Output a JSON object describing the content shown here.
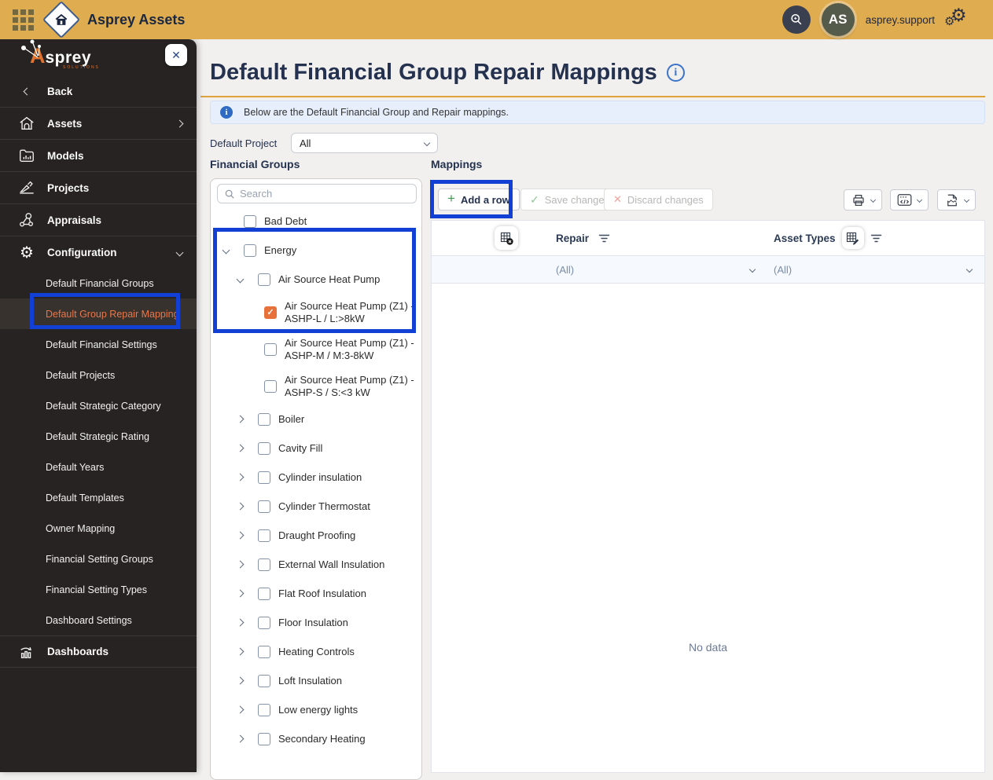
{
  "topbar": {
    "app_title": "Asprey Assets",
    "username": "asprey.support",
    "avatar_initials": "AS"
  },
  "sidebar": {
    "logo_text_a": "A",
    "logo_text_rest": "sprey",
    "logo_sub": "SOLUTIONS",
    "close_glyph": "✕",
    "back_label": "Back",
    "items": [
      {
        "label": "Assets"
      },
      {
        "label": "Models"
      },
      {
        "label": "Projects"
      },
      {
        "label": "Appraisals"
      },
      {
        "label": "Configuration"
      }
    ],
    "config_children": [
      "Default Financial Groups",
      "Default Group Repair Mapping",
      "Default Financial Settings",
      "Default Projects",
      "Default Strategic Category",
      "Default Strategic Rating",
      "Default Years",
      "Default Templates",
      "Owner Mapping",
      "Financial Setting Groups",
      "Financial Setting Types",
      "Dashboard Settings"
    ],
    "active_child": "Default Group Repair Mapping",
    "dashboards_label": "Dashboards"
  },
  "page": {
    "title": "Default Financial Group Repair Mappings",
    "info_glyph": "i",
    "banner_text": "Below are the Default Financial Group and Repair mappings.",
    "default_project_label": "Default Project",
    "default_project_value": "All"
  },
  "financial_groups": {
    "title": "Financial Groups",
    "search_placeholder": "Search",
    "tree": [
      {
        "label": "Bad Debt",
        "level": 0,
        "chevron": "none",
        "checked": false
      },
      {
        "label": "Energy",
        "level": 0,
        "chevron": "down",
        "checked": false
      },
      {
        "label": "Air Source Heat Pump",
        "level": 1,
        "chevron": "down",
        "checked": false
      },
      {
        "label": "Air Source Heat Pump (Z1) - ASHP-L / L:>8kW",
        "level": 2,
        "chevron": "none",
        "checked": true
      },
      {
        "label": "Air Source Heat Pump (Z1) - ASHP-M / M:3-8kW",
        "level": 2,
        "chevron": "none",
        "checked": false
      },
      {
        "label": "Air Source Heat Pump (Z1) - ASHP-S / S:<3 kW",
        "level": 2,
        "chevron": "none",
        "checked": false
      },
      {
        "label": "Boiler",
        "level": 1,
        "chevron": "right",
        "checked": false
      },
      {
        "label": "Cavity Fill",
        "level": 1,
        "chevron": "right",
        "checked": false
      },
      {
        "label": "Cylinder insulation",
        "level": 1,
        "chevron": "right",
        "checked": false
      },
      {
        "label": "Cylinder Thermostat",
        "level": 1,
        "chevron": "right",
        "checked": false
      },
      {
        "label": "Draught Proofing",
        "level": 1,
        "chevron": "right",
        "checked": false
      },
      {
        "label": "External Wall Insulation",
        "level": 1,
        "chevron": "right",
        "checked": false
      },
      {
        "label": "Flat Roof Insulation",
        "level": 1,
        "chevron": "right",
        "checked": false
      },
      {
        "label": "Floor Insulation",
        "level": 1,
        "chevron": "right",
        "checked": false
      },
      {
        "label": "Heating Controls",
        "level": 1,
        "chevron": "right",
        "checked": false
      },
      {
        "label": "Loft Insulation",
        "level": 1,
        "chevron": "right",
        "checked": false
      },
      {
        "label": "Low energy lights",
        "level": 1,
        "chevron": "right",
        "checked": false
      },
      {
        "label": "Secondary Heating",
        "level": 1,
        "chevron": "right",
        "checked": false
      }
    ],
    "checked_glyph": "✓"
  },
  "mappings": {
    "title": "Mappings",
    "toolbar": {
      "add_row_label": "Add a row",
      "add_glyph": "+",
      "save_label": "Save changes",
      "save_glyph": "✓",
      "discard_label": "Discard changes",
      "discard_glyph": "✕"
    },
    "table": {
      "columns": [
        "Repair",
        "Asset Types"
      ],
      "filter_values": [
        "(All)",
        "(All)"
      ],
      "empty_text": "No data"
    }
  },
  "icons": {
    "apps-grid-icon": "3x3-dot-grid",
    "home-icon": "house-in-diamond",
    "search-icon": "magnifier",
    "settings-gears-icon": "⚙⚙",
    "close-icon": "✕",
    "info-icon": "ⓘ",
    "chevron-right-icon": "›",
    "chevron-down-icon": "⌄",
    "chevron-left-icon": "‹",
    "add-icon": "+",
    "save-check-icon": "✓",
    "discard-x-icon": "✕",
    "print-icon": "printer",
    "code-export-icon": "</>",
    "file-export-icon": "torn-document",
    "delete-column-icon": "grid-with-x-badge",
    "edit-column-icon": "grid-with-pencil",
    "filter-icon": "shrinking-lines"
  },
  "colors": {
    "topbar": "#DFAC4F",
    "sidebar_bg": "#262322",
    "active_orange": "#E8774A",
    "annotation_blue": "#1240D4",
    "title_navy": "#24324F",
    "gold_underline": "#DFA33C",
    "banner_bg": "#E6EFFB",
    "banner_icon": "#2F6BC4",
    "checked_checkbox": "#E8703A",
    "filter_row_bg": "#F6F9FD",
    "muted_blue_gray": "#6B7A99"
  }
}
